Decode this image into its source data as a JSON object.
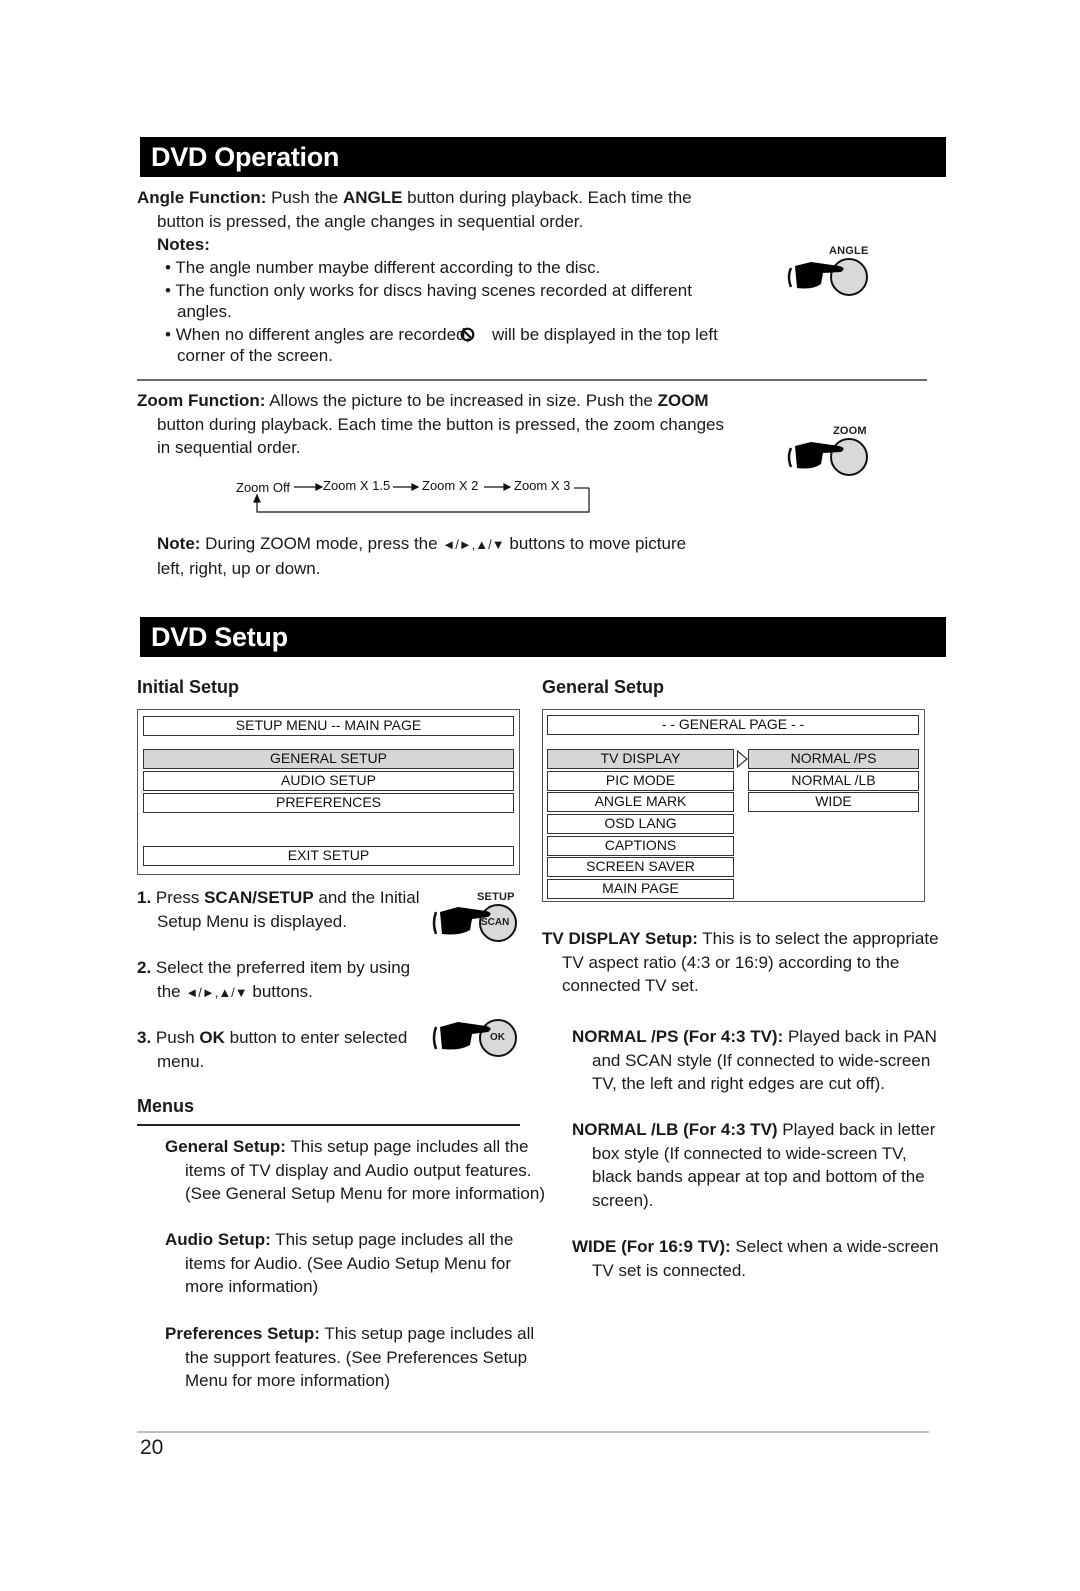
{
  "sections": {
    "operation_title": "DVD Operation",
    "setup_title": "DVD Setup"
  },
  "angle": {
    "label": "Angle Function:",
    "text1": " Push the ",
    "button": "ANGLE",
    "text2": " button during playback. Each time the button is pressed, the angle changes in sequential order.",
    "notes_label": "Notes:",
    "notes": [
      "The angle number maybe different according to the disc.",
      "The function only works for discs having scenes recorded at different angles."
    ],
    "note3_before": "When no different angles are recorded,",
    "note3_after": " will be displayed in the top left corner of the screen.",
    "icon_label": "ANGLE"
  },
  "zoom": {
    "label": "Zoom Function:",
    "text1": " Allows the picture to be increased in size. Push the ",
    "button": "ZOOM",
    "text2": " button during playback. Each time the button is pressed, the zoom changes in sequential order.",
    "icon_label": "ZOOM",
    "flow": [
      "Zoom Off",
      "Zoom X 1.5",
      "Zoom X 2",
      "Zoom X 3"
    ],
    "note_label": "Note:",
    "note_before": " During ZOOM mode, press the ",
    "note_arrows": "◄/►,▲/▼",
    "note_after": " buttons to move picture left, right, up or down."
  },
  "initial_setup": {
    "heading": "Initial Setup",
    "menu_title": "SETUP MENU -- MAIN PAGE",
    "items": [
      "GENERAL SETUP",
      "AUDIO SETUP",
      "PREFERENCES"
    ],
    "selected_item": "GENERAL SETUP",
    "exit": "EXIT SETUP",
    "steps": [
      {
        "num": "1.",
        "before": " Press ",
        "bold": "SCAN/SETUP",
        "after": " and the Initial Setup Menu is displayed."
      },
      {
        "num": "2.",
        "before": " Select the preferred item by using the ",
        "arrows": "◄/►,▲/▼",
        "after": " buttons."
      },
      {
        "num": "3.",
        "before": " Push ",
        "bold": "OK",
        "after": " button to enter selected menu."
      }
    ],
    "setup_icon_top": "SETUP",
    "setup_icon_inner": "SCAN",
    "ok_icon_inner": "OK"
  },
  "menus": {
    "heading": "Menus",
    "entries": [
      {
        "label": "General Setup:",
        "text": " This setup page includes all the items of TV display and Audio output features. (See General Setup Menu for more information)"
      },
      {
        "label": "Audio Setup:",
        "text": " This setup page includes all the items for Audio. (See Audio Setup Menu for more information)"
      },
      {
        "label": "Preferences Setup:",
        "text": " This setup page includes all the support features. (See Preferences Setup Menu for more information)"
      }
    ]
  },
  "general_setup": {
    "heading": "General Setup",
    "page_title": "- - GENERAL PAGE - -",
    "items": [
      "TV DISPLAY",
      "PIC MODE",
      "ANGLE MARK",
      "OSD LANG",
      "CAPTIONS",
      "SCREEN SAVER",
      "MAIN PAGE"
    ],
    "selected_item": "TV DISPLAY",
    "options": [
      "NORMAL /PS",
      "NORMAL /LB",
      "WIDE"
    ],
    "selected_option": "NORMAL /PS",
    "tv_display_label": "TV DISPLAY Setup:",
    "tv_display_text": " This is to select the appropriate TV aspect ratio (4:3 or 16:9) according to the connected TV set.",
    "option_desc": [
      {
        "label": "NORMAL /PS (For 4:3 TV):",
        "text": " Played back in PAN and SCAN style (If connected to wide-screen TV, the left and right edges are cut off)."
      },
      {
        "label": "NORMAL /LB (For 4:3 TV)",
        "text": " Played back in letter box style (If connected to wide-screen TV, black bands appear at top and bottom of the screen)."
      },
      {
        "label": "WIDE (For 16:9 TV):",
        "text": " Select when a wide-screen TV set is connected."
      }
    ]
  },
  "footer": {
    "page_number": "20"
  }
}
